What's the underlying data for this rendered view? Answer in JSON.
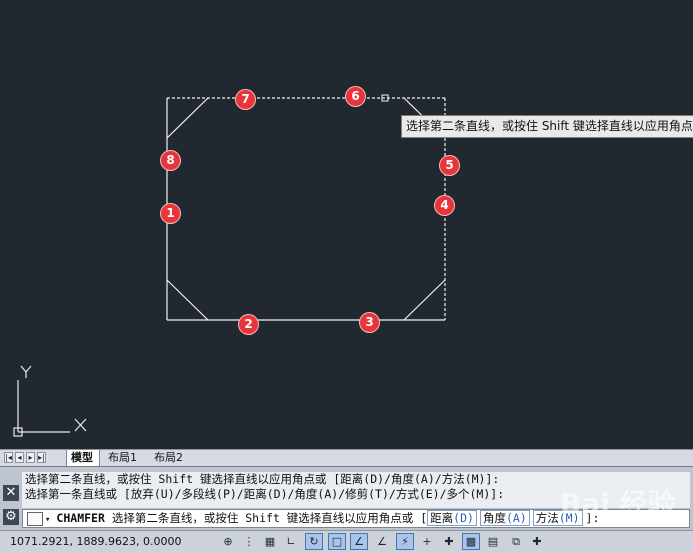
{
  "tooltip": {
    "text": "选择第二条直线，或按住 Shift 键选择直线以应用角点或"
  },
  "markers": [
    "1",
    "2",
    "3",
    "4",
    "5",
    "6",
    "7",
    "8"
  ],
  "axis": {
    "y": "Y",
    "x": "X"
  },
  "tabs": {
    "model": "模型",
    "layout1": "布局1",
    "layout2": "布局2"
  },
  "command": {
    "history_line1": "选择第二条直线，或按住 Shift 键选择直线以应用角点或 [距离(D)/角度(A)/方法(M)]:",
    "history_line2": "选择第一条直线或 [放弃(U)/多段线(P)/距离(D)/角度(A)/修剪(T)/方式(E)/多个(M)]:",
    "name": "CHAMFER",
    "prompt": "选择第二条直线，或按住 Shift 键选择直线以应用角点或",
    "opt_distance": "距离",
    "opt_distance_key": "(D)",
    "opt_angle": "角度",
    "opt_angle_key": "(A)",
    "opt_method": "方法",
    "opt_method_key": "(M)",
    "tail": "]:"
  },
  "status": {
    "coordinates": "1071.2921, 1889.9623, 0.0000"
  },
  "watermark": "Bai 经验"
}
